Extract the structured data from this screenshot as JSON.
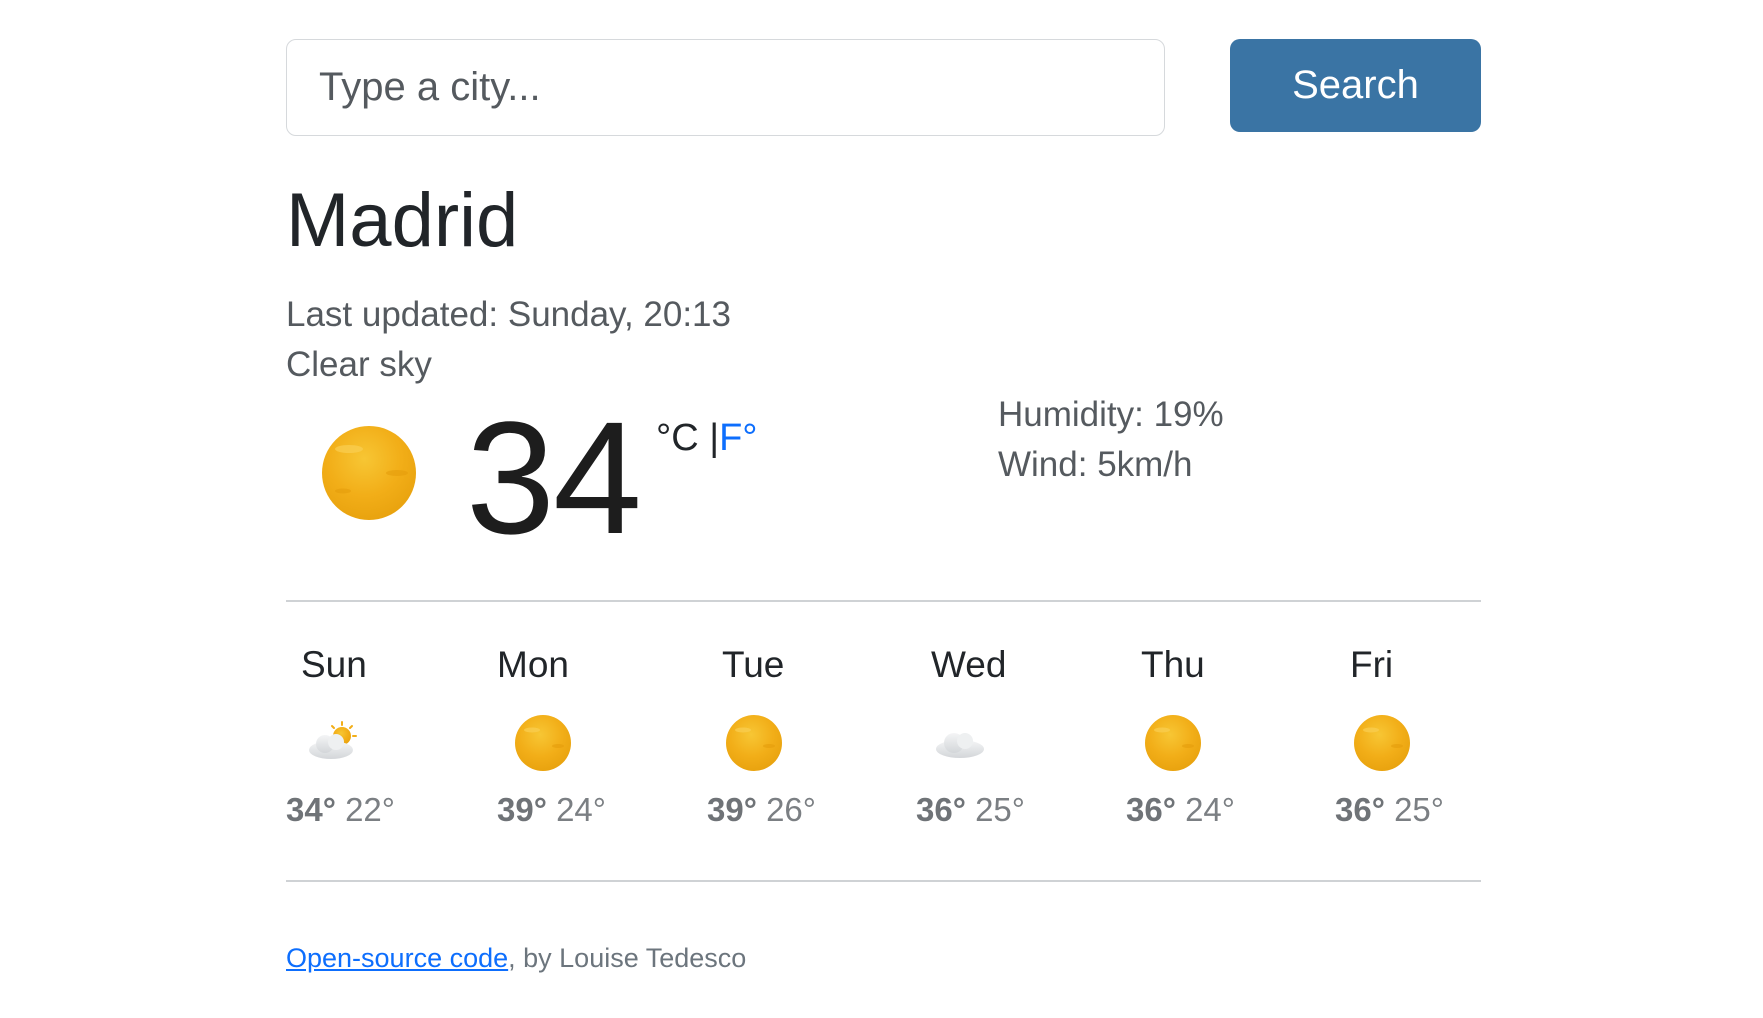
{
  "search": {
    "placeholder": "Type a city...",
    "button_label": "Search"
  },
  "city": {
    "name": "Madrid",
    "last_updated": "Last updated: Sunday, 20:13",
    "description": "Clear sky"
  },
  "current": {
    "icon": "sun-icon",
    "temperature": "34",
    "unit_celsius": "°C",
    "unit_separator": "|",
    "unit_fahrenheit": "F°",
    "humidity": "Humidity: 19%",
    "wind": "Wind: 5km/h"
  },
  "forecast": [
    {
      "day": "Sun",
      "icon": "partly-cloudy-icon",
      "max": "34°",
      "min": "22°"
    },
    {
      "day": "Mon",
      "icon": "sun-icon",
      "max": "39°",
      "min": "24°"
    },
    {
      "day": "Tue",
      "icon": "sun-icon",
      "max": "39°",
      "min": "26°"
    },
    {
      "day": "Wed",
      "icon": "cloud-icon",
      "max": "36°",
      "min": "25°"
    },
    {
      "day": "Thu",
      "icon": "sun-icon",
      "max": "36°",
      "min": "24°"
    },
    {
      "day": "Fri",
      "icon": "sun-icon",
      "max": "36°",
      "min": "25°"
    }
  ],
  "footer": {
    "link_text": "Open-source code",
    "author_text": ", by Louise Tedesco"
  },
  "colors": {
    "button": "#3a74a4",
    "link": "#0d6efd",
    "sun": "#f5b916"
  }
}
